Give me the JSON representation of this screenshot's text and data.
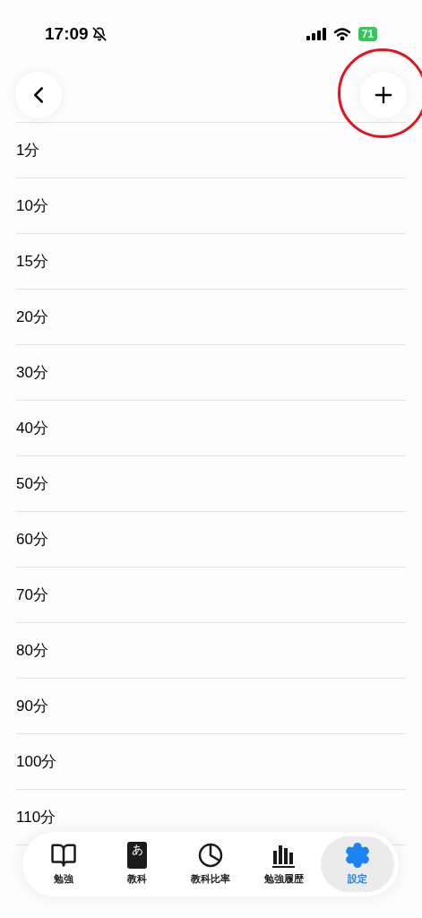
{
  "status_bar": {
    "time": "17:09",
    "battery": "71"
  },
  "nav": {
    "add_button": {
      "annotated": true
    }
  },
  "rows": [
    "1分",
    "10分",
    "15分",
    "20分",
    "30分",
    "40分",
    "50分",
    "60分",
    "70分",
    "80分",
    "90分",
    "100分",
    "110分"
  ],
  "tabs": [
    {
      "kind": "book",
      "label": "勉強",
      "selected": false
    },
    {
      "kind": "dictionary",
      "glyph": "あ",
      "label": "教科",
      "selected": false
    },
    {
      "kind": "pie",
      "label": "教科比率",
      "selected": false
    },
    {
      "kind": "bars",
      "label": "勉強履歴",
      "selected": false
    },
    {
      "kind": "gear",
      "label": "設定",
      "selected": true
    }
  ]
}
